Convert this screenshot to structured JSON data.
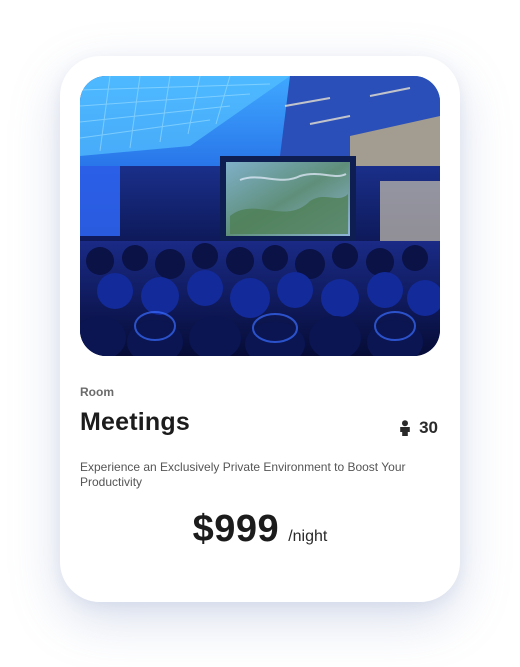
{
  "room_card": {
    "category": "Room",
    "title": "Meetings",
    "capacity": "30",
    "capacity_icon": "person-icon",
    "description": "Experience an Exclusively Private Environment to Boost Your Productivity",
    "price": "$999",
    "price_unit": "/night",
    "image_subject": "audience watching a presentation on a large screen in a blue-lit conference hall"
  },
  "colors": {
    "card_background": "#ffffff",
    "title_text": "#1c1c1c",
    "muted_text": "#6b6b6b",
    "shadow": "#788cbe"
  }
}
